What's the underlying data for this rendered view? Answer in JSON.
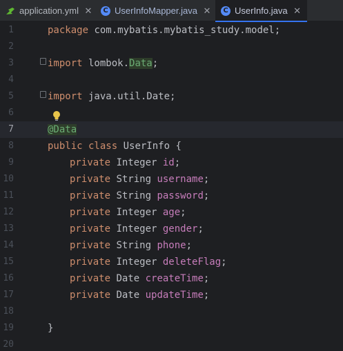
{
  "tabs": [
    {
      "label": "application.yml",
      "close": "✕",
      "icon": "yml-file-icon"
    },
    {
      "label": "UserInfoMapper.java",
      "close": "✕",
      "icon": "class-icon"
    },
    {
      "label": "UserInfo.java",
      "close": "✕",
      "icon": "class-icon",
      "active": true
    }
  ],
  "class_icon_letter": "C",
  "gutter": [
    "1",
    "2",
    "3",
    "4",
    "5",
    "6",
    "7",
    "8",
    "9",
    "10",
    "11",
    "12",
    "13",
    "14",
    "15",
    "16",
    "17",
    "18",
    "19",
    "20"
  ],
  "code": {
    "l1_kw": "package",
    "l1_rest": " com.mybatis.mybatis_study.model;",
    "l3_kw": "import",
    "l3_rest": " lombok.",
    "l3_cls": "Data",
    "l3_end": ";",
    "l5_kw": "import",
    "l5_rest": " java.util.Date;",
    "l7_ann": "@Data",
    "l8_kw": "public class",
    "l8_rest": " UserInfo {",
    "fields": [
      {
        "mod": "private",
        "type": " Integer ",
        "name": "id",
        "end": ";"
      },
      {
        "mod": "private",
        "type": " String ",
        "name": "username",
        "end": ";"
      },
      {
        "mod": "private",
        "type": " String ",
        "name": "password",
        "end": ";"
      },
      {
        "mod": "private",
        "type": " Integer ",
        "name": "age",
        "end": ";"
      },
      {
        "mod": "private",
        "type": " Integer ",
        "name": "gender",
        "end": ";"
      },
      {
        "mod": "private",
        "type": " String ",
        "name": "phone",
        "end": ";"
      },
      {
        "mod": "private",
        "type": " Integer ",
        "name": "deleteFlag",
        "end": ";"
      },
      {
        "mod": "private",
        "type": " Date ",
        "name": "createTime",
        "end": ";"
      },
      {
        "mod": "private",
        "type": " Date ",
        "name": "updateTime",
        "end": ";"
      }
    ],
    "l19_brace": "}"
  },
  "colors": {
    "keyword": "#cf8e6d",
    "field": "#c77dbb",
    "annotation": "#b3ae60",
    "accent": "#3574f0"
  }
}
